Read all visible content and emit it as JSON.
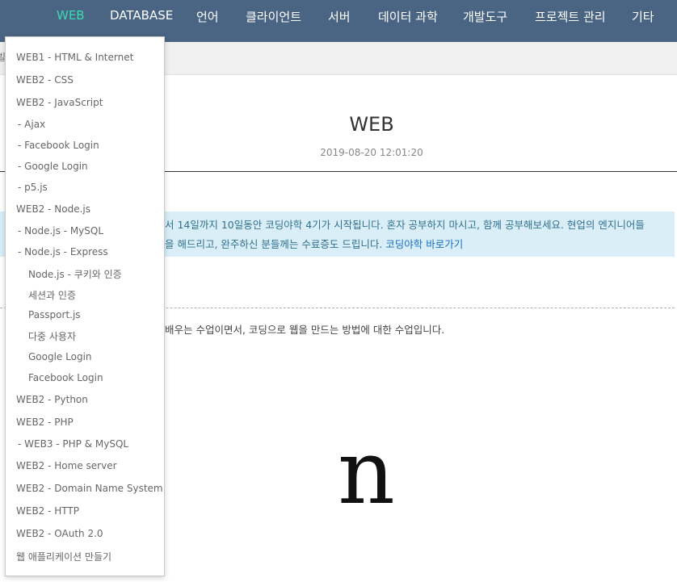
{
  "nav": {
    "items": [
      "WEB",
      "DATABASE",
      "언어",
      "클라이언트",
      "서버",
      "데이터 과학",
      "개발도구",
      "프로젝트 관리",
      "기타"
    ],
    "active_color": "#3dd9b3",
    "bar_color": "#4a6583"
  },
  "subbar": {
    "fragment": "빌"
  },
  "article": {
    "title": "WEB",
    "date": "2019-08-20 12:01:20",
    "notice_line1": "서 14일까지 10일동안 코딩야학 4기가 시작됩니다. 혼자 공부하지 마시고, 함께 공부해보세요. 현업의 엔지니어들",
    "notice_line2_text": "을 해드리고, 완주하신 분들께는 수료증도 드립니다. ",
    "notice_link": "코딩야학 바로가기",
    "intro": "배우는 수업이면서, 코딩으로 웹을 만드는 방법에 대한 수업입니다.",
    "glyph": "n"
  },
  "dropdown": {
    "items": [
      "WEB1 - HTML & Internet",
      "WEB2 - CSS",
      "WEB2 - JavaScript",
      "- Ajax",
      "- Facebook Login",
      "- Google Login",
      "- p5.js",
      "WEB2 - Node.js",
      "- Node.js - MySQL",
      "- Node.js - Express",
      "Node.js - 쿠키와 인증",
      "세션과 인증",
      "Passport.js",
      "다중 사용자",
      "Google Login",
      "Facebook Login",
      "WEB2 - Python",
      "WEB2 - PHP",
      "- WEB3 - PHP & MySQL",
      "WEB2 - Home server",
      "WEB2 - Domain Name System",
      "WEB2 - HTTP",
      "WEB2 - OAuth 2.0",
      "웹 애플리케이션 만들기"
    ]
  }
}
